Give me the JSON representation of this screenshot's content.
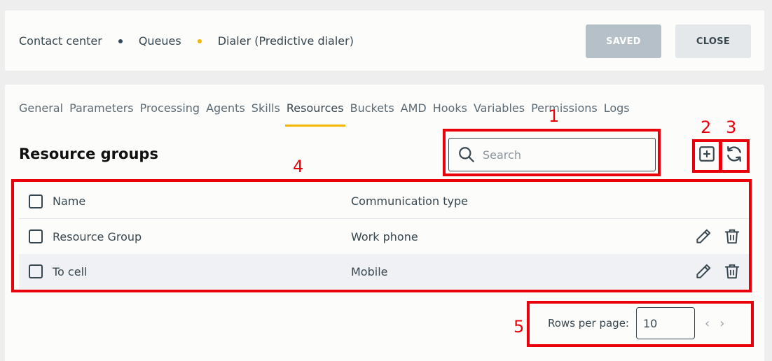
{
  "breadcrumb": {
    "items": [
      "Contact center",
      "Queues",
      "Dialer (Predictive dialer)"
    ],
    "dot_colors": [
      "#34495e",
      "#f4b400"
    ]
  },
  "header_buttons": {
    "saved": "SAVED",
    "close": "CLOSE"
  },
  "tabs": [
    "General",
    "Parameters",
    "Processing",
    "Agents",
    "Skills",
    "Resources",
    "Buckets",
    "AMD",
    "Hooks",
    "Variables",
    "Permissions",
    "Logs"
  ],
  "active_tab": "Resources",
  "section": {
    "title": "Resource groups"
  },
  "search": {
    "placeholder": "Search",
    "value": ""
  },
  "table": {
    "columns": [
      "Name",
      "Communication type"
    ],
    "rows": [
      {
        "name": "Resource Group",
        "type": "Work phone"
      },
      {
        "name": "To cell",
        "type": "Mobile"
      }
    ]
  },
  "pagination": {
    "label": "Rows per page:",
    "value": "10"
  },
  "annotations": [
    "1",
    "2",
    "3",
    "4",
    "5"
  ],
  "colors": {
    "accent": "#f4b400",
    "annotation": "#e8000b",
    "saved_bg": "#b5c0c8"
  }
}
